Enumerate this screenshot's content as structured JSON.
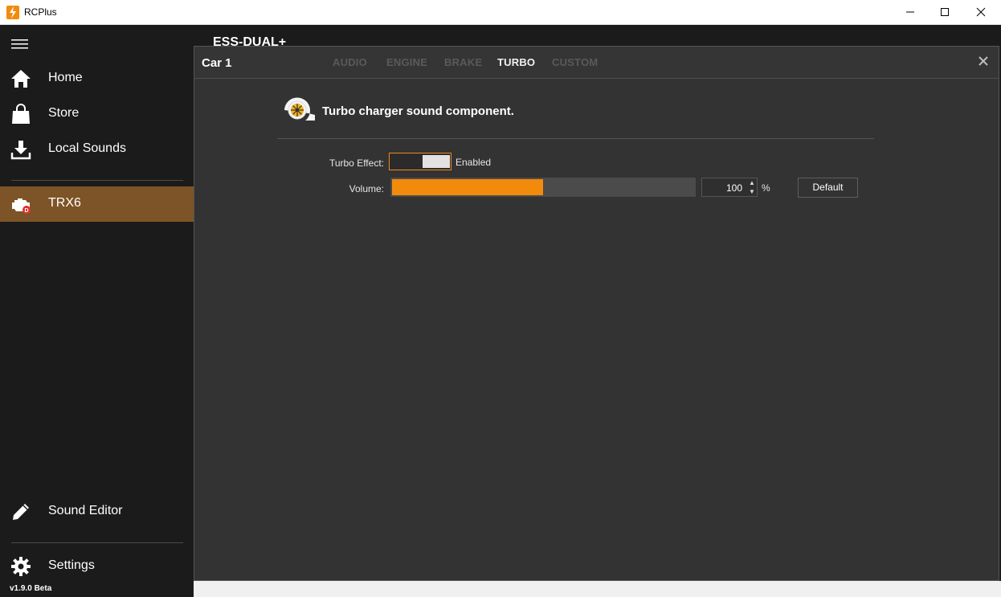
{
  "window": {
    "title": "RCPlus",
    "minimize_symbol": "—",
    "maximize_symbol": "☐",
    "close_symbol": "✕"
  },
  "sidebar": {
    "items": [
      {
        "label": "Home",
        "icon": "home-icon"
      },
      {
        "label": "Store",
        "icon": "shopping-bag-icon"
      },
      {
        "label": "Local Sounds",
        "icon": "download-icon"
      },
      {
        "label": "TRX6",
        "icon": "engine-icon",
        "active": true
      },
      {
        "label": "Sound Editor",
        "icon": "pencil-icon"
      },
      {
        "label": "Settings",
        "icon": "gear-icon"
      }
    ],
    "version": "v1.9.0 Beta"
  },
  "background_title": "ESS-DUAL+",
  "dialog": {
    "title": "Car 1",
    "tabs": [
      "AUDIO",
      "ENGINE",
      "BRAKE",
      "TURBO",
      "CUSTOM"
    ],
    "active_tab": "TURBO",
    "heading": "Turbo charger sound component.",
    "turbo_effect": {
      "label": "Turbo Effect:",
      "state_text": "Enabled",
      "enabled": true
    },
    "volume": {
      "label": "Volume:",
      "value": "100",
      "level_fraction": 0.5,
      "unit": "%",
      "default_label": "Default"
    }
  },
  "colors": {
    "accent": "#f28b0c",
    "active_nav": "#7d5427",
    "sidebar_bg": "#1b1b1b",
    "panel_bg": "#333333"
  }
}
